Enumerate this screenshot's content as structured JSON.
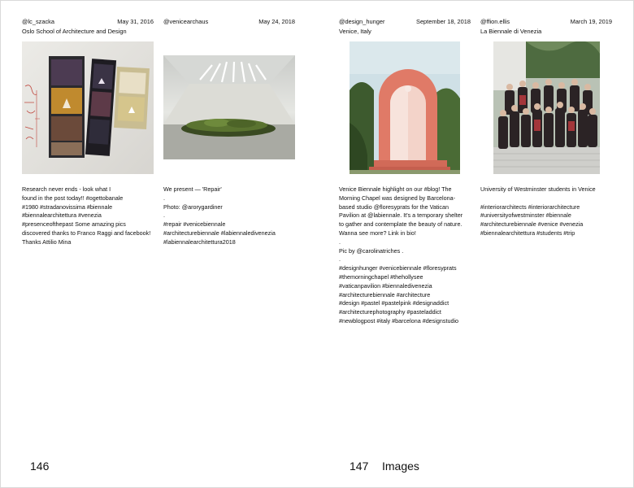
{
  "left_page": {
    "page_number": "146",
    "posts": [
      {
        "handle": "@lc_szacka",
        "date": "May 31, 2016",
        "location": "Oslo School of Architecture and Design",
        "caption": "Research never ends - look what I\nfound in the post today!! #ogettobanale\n#1980 #stradanovissima #biennale\n#biennalearchitettura #venezia\n#presenceofthepast Some amazing pics\ndiscovered thanks to Franco Raggi and facebook!\nThanks Attilio Mina"
      },
      {
        "handle": "@venicearchaus",
        "date": "May 24, 2018",
        "location": "",
        "caption": "We present — 'Repair'\n.\nPhoto: @arorygardiner\n.\n#repair #venicebiennale\n#architecturebiennale #labiennaledivenezia\n#labiennalearchitettura2018"
      }
    ]
  },
  "right_page": {
    "page_number": "147",
    "section_title": "Images",
    "posts": [
      {
        "handle": "@design_hunger",
        "date": "September 18, 2018",
        "location": "Venice, Italy",
        "caption": "Venice Biennale highlight on our #blog! The\nMorning Chapel was designed by Barcelona-\nbased studio @floresyprats for the Vatican\nPavilion at @labiennale. It's a temporary shelter\nto gather and contemplate the beauty of nature.\nWanna see more? Link in bio!\n.\nPic by @carolinatriches .\n.\n#designhunger #venicebiennale #floresyprats\n#themorningchapel #thehollysee\n#vaticanpavilion #biennaledivenezia\n#architecturebiennale #architecture\n#design #pastel #pastelpink #designaddict\n#architecturephotography #pasteladdict\n#newblogpost #italy #barcelona #designstudio"
      },
      {
        "handle": "@ffion.ellis",
        "date": "March 19, 2019",
        "location": "La Biennale di Venezia",
        "caption": "University of Westminster students in Venice\n\n#interiorarchitects #interiorarchitecture\n#universityofwestminster #biennale\n#architecturebiennale #venice #venezia\n#biennalearchitettura #students #trip"
      }
    ]
  }
}
